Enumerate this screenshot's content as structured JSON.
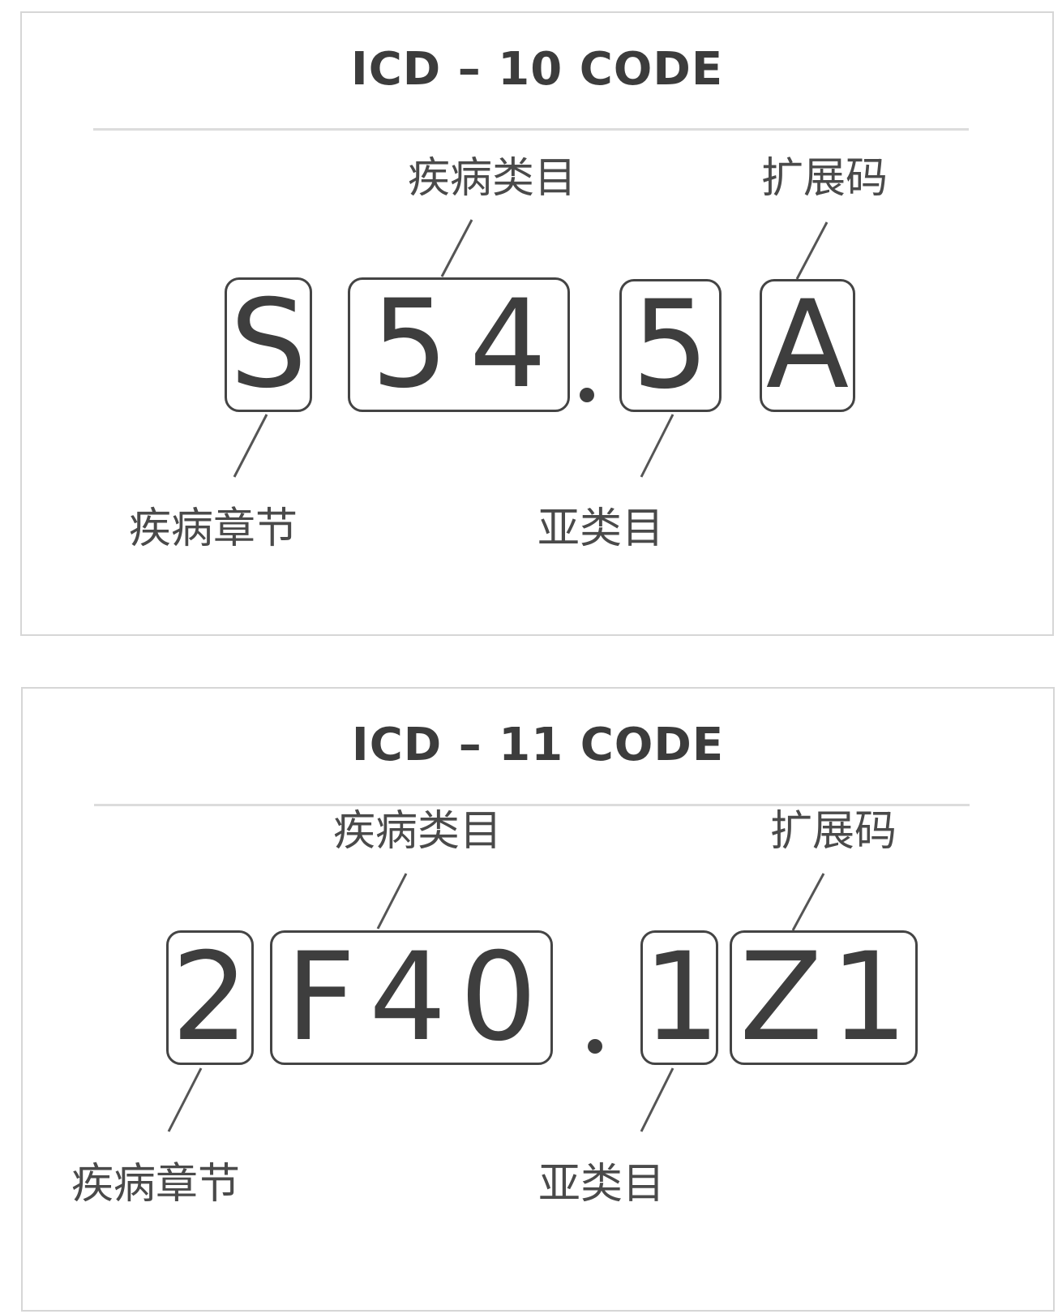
{
  "icd10": {
    "title": "ICD – 10 CODE",
    "parts": {
      "chapter": "S",
      "category": [
        "5",
        "4"
      ],
      "dot": ".",
      "subcategory": "5",
      "extension": "A"
    },
    "labels": {
      "category": "疾病类目",
      "extension": "扩展码",
      "chapter": "疾病章节",
      "subcategory": "亚类目"
    }
  },
  "icd11": {
    "title": "ICD – 11 CODE",
    "parts": {
      "chapter": "2",
      "category": [
        "F",
        "4",
        "0"
      ],
      "dot": ".",
      "subcategory": "1",
      "extension": [
        "Z",
        "1"
      ]
    },
    "labels": {
      "category": "疾病类目",
      "extension": "扩展码",
      "chapter": "疾病章节",
      "subcategory": "亚类目"
    }
  },
  "colors": {
    "box_border": "#444444",
    "text": "#3e3e3e",
    "panel_border": "#d6d6d6",
    "rule": "#dcdcdc"
  }
}
